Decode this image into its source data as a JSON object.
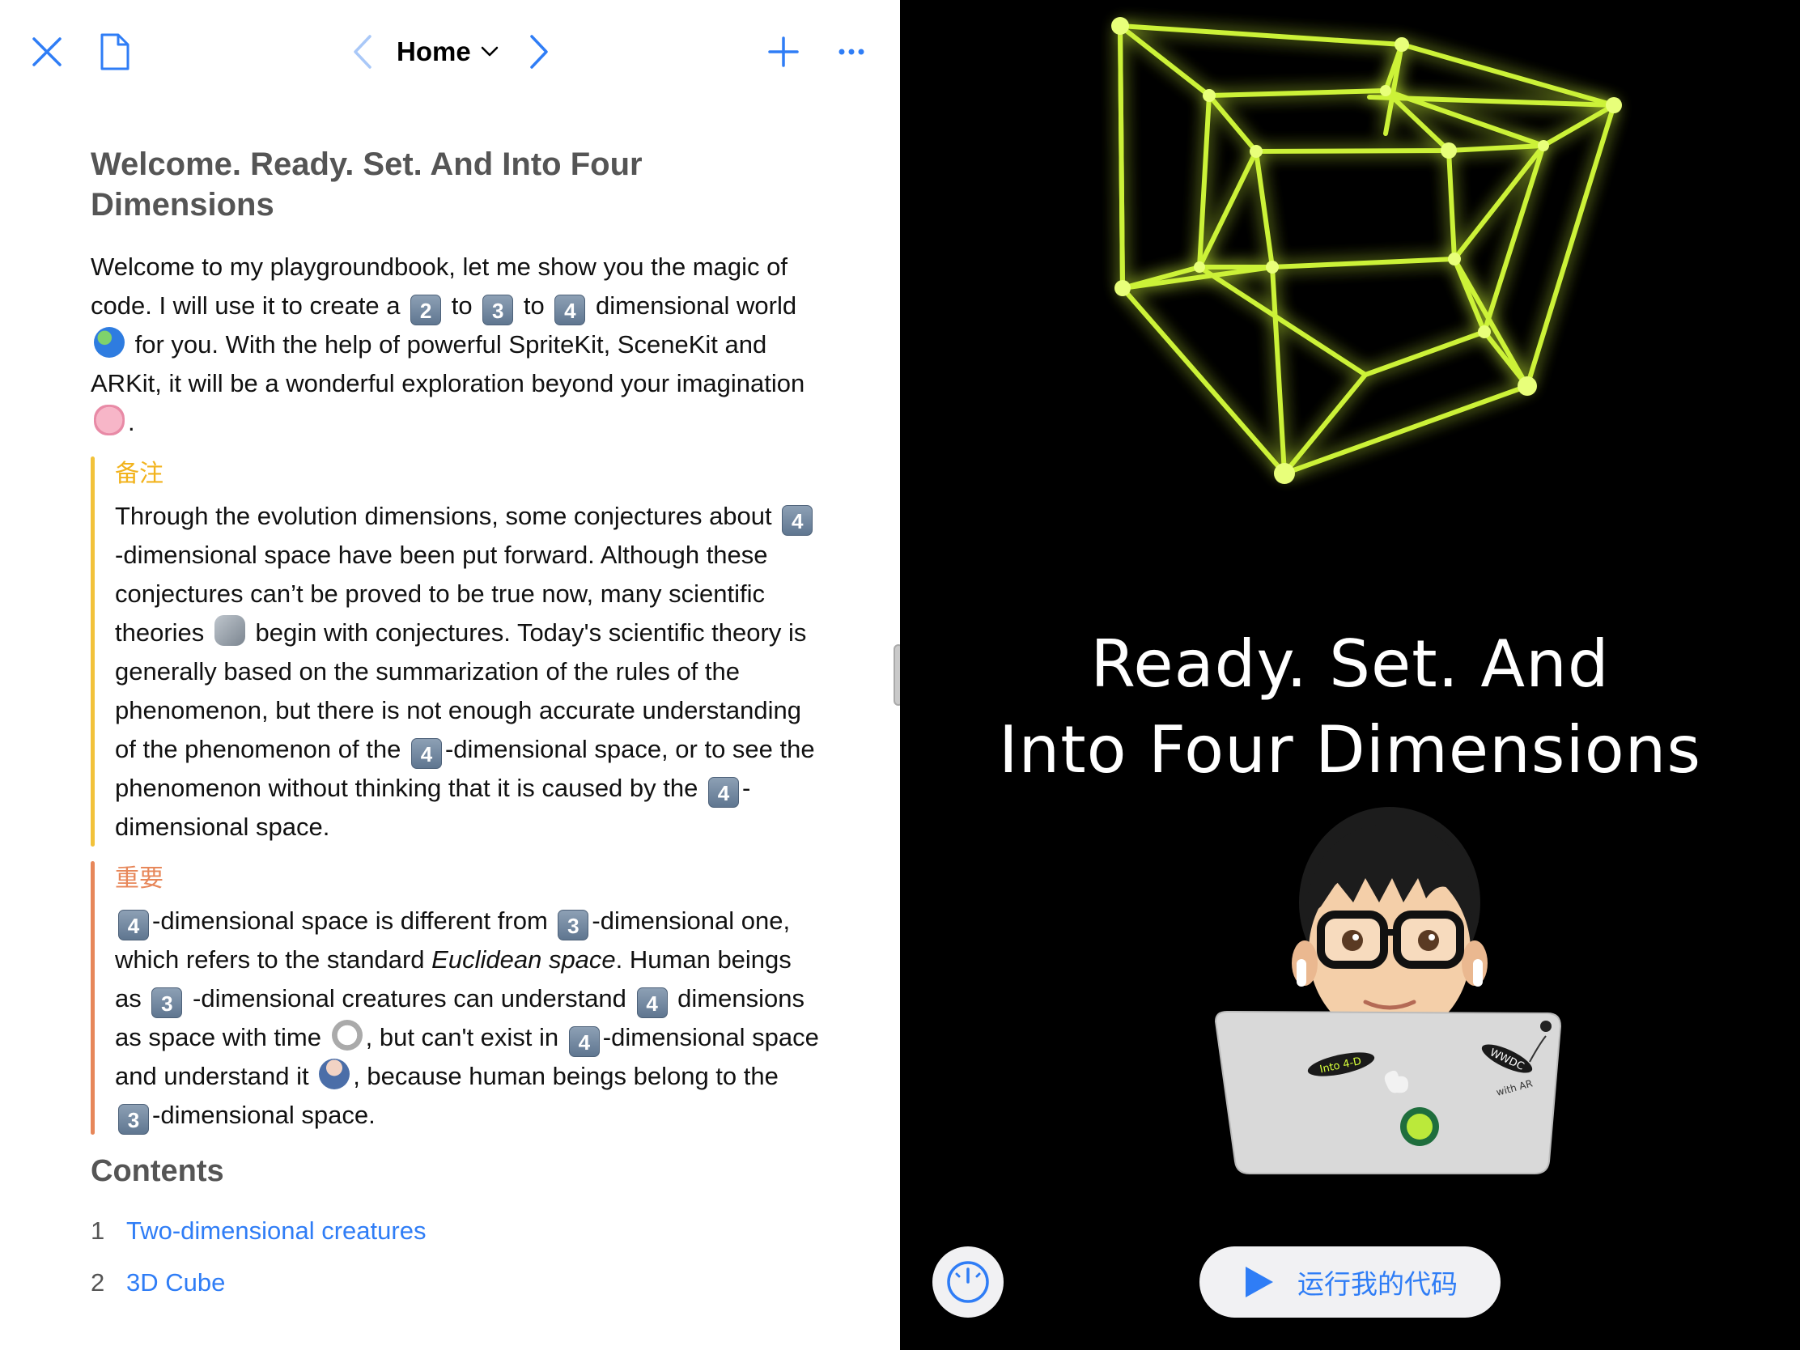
{
  "toolbar": {
    "title": "Home",
    "icons": {
      "close": "close-icon",
      "document": "document-icon",
      "back": "chevron-left-icon",
      "forward": "chevron-right-icon",
      "title_menu": "chevron-down-icon",
      "add": "plus-icon",
      "more": "ellipsis-icon"
    },
    "accent": "#2f7df6"
  },
  "article": {
    "title": "Welcome. Ready. Set. And Into Four Dimensions",
    "intro": {
      "t1": "Welcome to my playgroundbook, let me show you the magic of code. I will use it to create a",
      "k2": "2",
      "t2": "to",
      "k3": "3",
      "t3": "to",
      "k4": "4",
      "t4": "dimensional world",
      "t5": "for you. With the help of powerful SpriteKit, SceneKit and ARKit, it will be a wonderful exploration beyond your imagination",
      "t6": "."
    },
    "note": {
      "tag": "备注",
      "a": "Through the evolution dimensions, some conjectures about",
      "k_a": "4",
      "b": "-dimensional space have been put forward. Although these conjectures can’t be proved to be true now, many scientific theories",
      "c": "begin with conjectures. Today's scientific theory is generally based on the summarization of the rules of the phenomenon, but there is not enough accurate understanding of the phenomenon of the",
      "k_c": "4",
      "d": "-dimensional space, or to see the phenomenon without thinking that it is caused by the",
      "k_d": "4",
      "e": "-dimensional space."
    },
    "important": {
      "tag": "重要",
      "k1": "4",
      "a": "-dimensional space is different from",
      "k2": "3",
      "b": "-dimensional one, which refers to the standard",
      "em": "Euclidean space",
      "c": ". Human beings as",
      "k3": "3",
      "d": "-dimensional creatures can understand",
      "k4": "4",
      "e": "dimensions as space with time",
      "f": ", but can't exist in",
      "k5": "4",
      "g": "-dimensional space and understand it",
      "h": ", because human beings belong to the",
      "k6": "3",
      "i": "-dimensional space."
    },
    "contents_heading": "Contents",
    "contents": [
      {
        "num": "1",
        "label": "Two-dimensional creatures"
      },
      {
        "num": "2",
        "label": "3D Cube"
      }
    ]
  },
  "live_view": {
    "title_line1": "Ready. Set. And",
    "title_line2": "Into Four Dimensions",
    "laptop_stickers": [
      "Into 4-D",
      "WWDC",
      "with AR"
    ],
    "run_button": "运行我的代码",
    "icons": {
      "speed": "speedometer-icon",
      "play": "play-icon"
    },
    "glow_color": "#d7ff3a"
  }
}
